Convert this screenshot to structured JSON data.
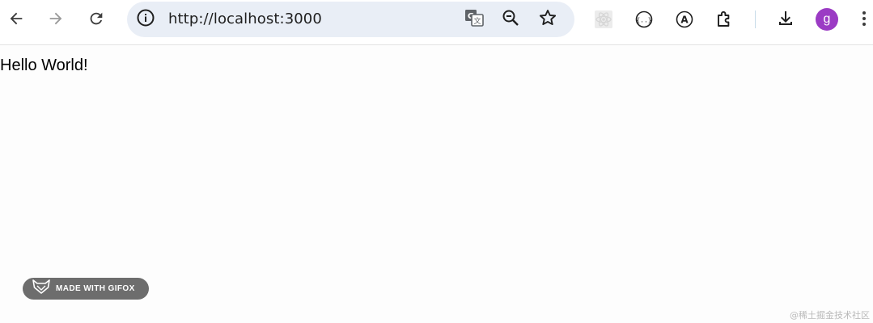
{
  "toolbar": {
    "back_icon": "arrow-left-icon",
    "forward_icon": "arrow-right-icon",
    "reload_icon": "reload-icon",
    "omnibox": {
      "url": "http://localhost:3000",
      "site_info_icon": "info-icon",
      "translate_icon": "google-translate-icon",
      "zoom_icon": "zoom-out-icon",
      "bookmark_icon": "star-icon"
    },
    "extensions": [
      {
        "name": "react-devtools-icon"
      },
      {
        "name": "json-extension-icon"
      },
      {
        "name": "font-extension-icon"
      },
      {
        "name": "puzzle-extensions-icon"
      }
    ],
    "download_icon": "download-icon",
    "profile_initial": "g",
    "profile_color": "#9b3bc4",
    "menu_icon": "kebab-menu-icon"
  },
  "page": {
    "body_text": "Hello World!"
  },
  "overlay": {
    "gifox_label": "MADE WITH GIFOX",
    "watermark": "@稀土掘金技术社区"
  },
  "colors": {
    "omnibox_bg": "#e9eef6",
    "badge_bg": "#6d6d6d"
  }
}
